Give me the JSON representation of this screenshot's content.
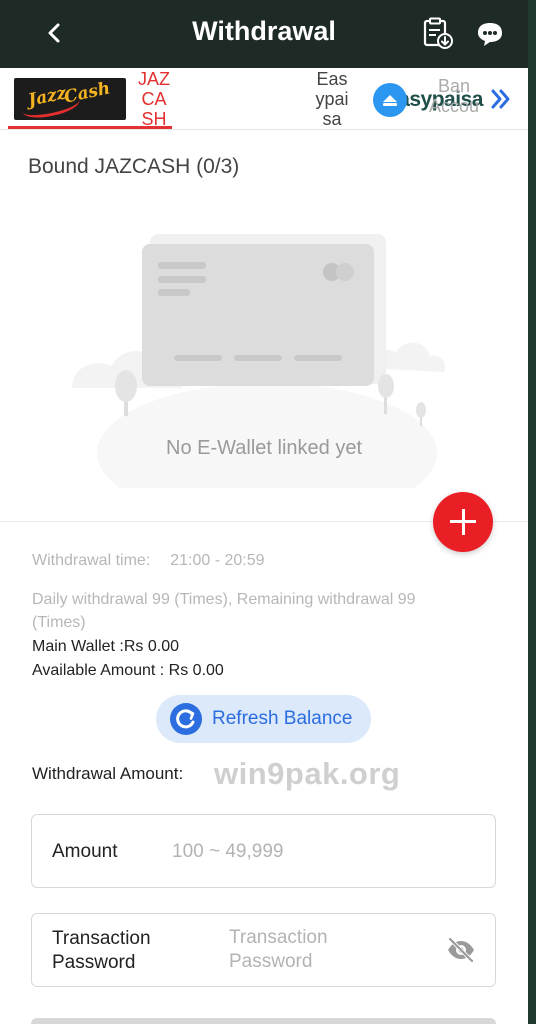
{
  "header": {
    "title": "Withdrawal",
    "back_icon": "chevron-left-icon",
    "records_icon": "clipboard-download-icon",
    "support_icon": "customer-service-chat-icon",
    "background_color": "#1d2a25"
  },
  "channels": {
    "items": [
      {
        "logo_text": "Jazz Cash",
        "label": "JAZ\nCA\nSH",
        "active": true
      },
      {
        "logo_text": "easypaisa",
        "label": "Eas\nypai\nsa",
        "active": false
      },
      {
        "label": "Ban\nAccou",
        "active": false
      }
    ],
    "more_icon": "double-chevron-right-icon",
    "active_color": "#e33030"
  },
  "bound": {
    "title": "Bound JAZCASH (0/3)",
    "empty_text": "No E-Wallet linked yet",
    "add_icon": "plus-icon",
    "add_color": "#ea1f25"
  },
  "info": {
    "withdrawal_time_label": "Withdrawal time:",
    "withdrawal_time_value": "21:00 - 20:59",
    "daily_line1": "Daily withdrawal 99 (Times), Remaining withdrawal 99",
    "daily_line2": "(Times)",
    "main_wallet": "Main Wallet :Rs 0.00",
    "available_amount": "Available Amount : Rs 0.00"
  },
  "refresh": {
    "label": "Refresh Balance",
    "icon": "refresh-icon",
    "color": "#2c6de0"
  },
  "withdrawal_amount_label": "Withdrawal Amount:",
  "watermark": "win9pak.org",
  "amount_field": {
    "label": "Amount",
    "placeholder": "100 ~ 49,999",
    "value": ""
  },
  "password_field": {
    "label": "Transaction\nPassword",
    "placeholder": "Transaction\nPassword",
    "value": "",
    "toggle_icon": "eye-off-icon"
  }
}
